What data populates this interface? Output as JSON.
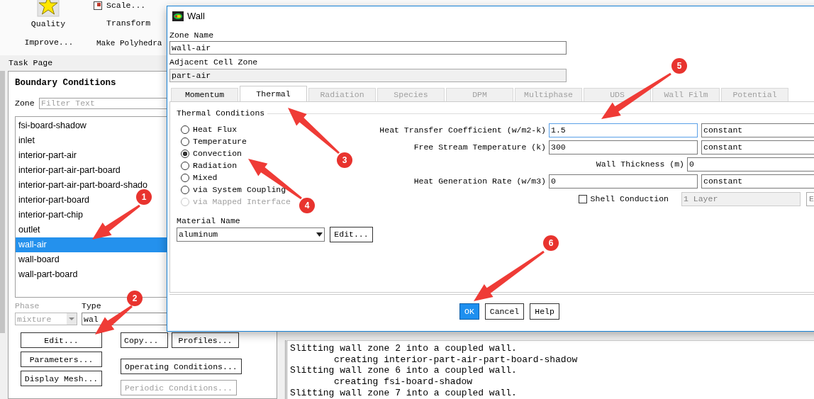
{
  "ribbon": {
    "quality": "Quality",
    "improve": "Improve...",
    "scale": "Scale...",
    "transform": "Transform",
    "make_polyhedra": "Make Polyhedra"
  },
  "task_page": {
    "header": "Task Page",
    "title": "Boundary Conditions",
    "zone_label": "Zone",
    "filter_placeholder": "Filter Text",
    "zones": [
      {
        "label": "fsi-board-shadow",
        "selected": false
      },
      {
        "label": "inlet",
        "selected": false
      },
      {
        "label": "interior-part-air",
        "selected": false
      },
      {
        "label": "interior-part-air-part-board",
        "selected": false
      },
      {
        "label": "interior-part-air-part-board-shado",
        "selected": false
      },
      {
        "label": "interior-part-board",
        "selected": false
      },
      {
        "label": "interior-part-chip",
        "selected": false
      },
      {
        "label": "outlet",
        "selected": false
      },
      {
        "label": "wall-air",
        "selected": true
      },
      {
        "label": "wall-board",
        "selected": false
      },
      {
        "label": "wall-part-board",
        "selected": false
      }
    ],
    "phase": {
      "label": "Phase",
      "value": "mixture",
      "disabled": true
    },
    "type": {
      "label": "Type",
      "value": "wal"
    },
    "buttons_left": [
      {
        "label": "Edit...",
        "disabled": false
      },
      {
        "label": "Parameters...",
        "disabled": false
      },
      {
        "label": "Display Mesh...",
        "disabled": false
      }
    ],
    "buttons_right_row": [
      {
        "label": "Copy...",
        "disabled": false
      },
      {
        "label": "Profiles...",
        "disabled": false
      }
    ],
    "buttons_right": [
      {
        "label": "Operating Conditions...",
        "disabled": false
      },
      {
        "label": "Periodic Conditions...",
        "disabled": true
      }
    ]
  },
  "dialog": {
    "title": "Wall",
    "zone_name": {
      "label": "Zone Name",
      "value": "wall-air"
    },
    "adjacent": {
      "label": "Adjacent Cell Zone",
      "value": "part-air"
    },
    "tabs": [
      {
        "label": "Momentum",
        "selected": false,
        "disabled": false
      },
      {
        "label": "Thermal",
        "selected": true,
        "disabled": false
      },
      {
        "label": "Radiation",
        "selected": false,
        "disabled": true
      },
      {
        "label": "Species",
        "selected": false,
        "disabled": true
      },
      {
        "label": "DPM",
        "selected": false,
        "disabled": true
      },
      {
        "label": "Multiphase",
        "selected": false,
        "disabled": true
      },
      {
        "label": "UDS",
        "selected": false,
        "disabled": true
      },
      {
        "label": "Wall Film",
        "selected": false,
        "disabled": true
      },
      {
        "label": "Potential",
        "selected": false,
        "disabled": true
      }
    ],
    "thermal_conditions": {
      "title": "Thermal Conditions",
      "options": [
        {
          "label": "Heat Flux",
          "selected": false,
          "disabled": false
        },
        {
          "label": "Temperature",
          "selected": false,
          "disabled": false
        },
        {
          "label": "Convection",
          "selected": true,
          "disabled": false
        },
        {
          "label": "Radiation",
          "selected": false,
          "disabled": false
        },
        {
          "label": "Mixed",
          "selected": false,
          "disabled": false
        },
        {
          "label": "via System Coupling",
          "selected": false,
          "disabled": false
        },
        {
          "label": "via Mapped Interface",
          "selected": false,
          "disabled": true
        }
      ]
    },
    "material": {
      "label": "Material Name",
      "value": "aluminum",
      "edit": "Edit..."
    },
    "properties": [
      {
        "label": "Heat Transfer Coefficient (w/m2-k)",
        "value": "1.5",
        "method": "constant",
        "focused": true
      },
      {
        "label": "Free Stream Temperature (k)",
        "value": "300",
        "method": "constant",
        "focused": false
      },
      {
        "label": "Wall Thickness (m)",
        "value": "0",
        "focused": false
      },
      {
        "label": "Heat Generation Rate (w/m3)",
        "value": "0",
        "method": "constant",
        "focused": false
      }
    ],
    "shell_conduction": {
      "label": "Shell Conduction",
      "checked": false
    },
    "layers": {
      "value": "1 Layer",
      "disabled": true,
      "button": "E"
    },
    "buttons": [
      {
        "label": "OK",
        "default": true
      },
      {
        "label": "Cancel",
        "default": false
      },
      {
        "label": "Help",
        "default": false
      }
    ]
  },
  "console": {
    "lines": [
      {
        "text": "Slitting wall zone 2 into a coupled wall.",
        "kind": "message"
      },
      {
        "text": "creating interior-part-air-part-board-shadow",
        "kind": "detail"
      },
      {
        "text": "Slitting wall zone 6 into a coupled wall.",
        "kind": "message"
      },
      {
        "text": "creating fsi-board-shadow",
        "kind": "detail"
      },
      {
        "text": "Slitting wall zone 7 into a coupled wall.",
        "kind": "message"
      }
    ]
  },
  "annotations": [
    {
      "label": "1"
    },
    {
      "label": "2"
    },
    {
      "label": "3"
    },
    {
      "label": "4"
    },
    {
      "label": "5"
    },
    {
      "label": "6"
    }
  ]
}
